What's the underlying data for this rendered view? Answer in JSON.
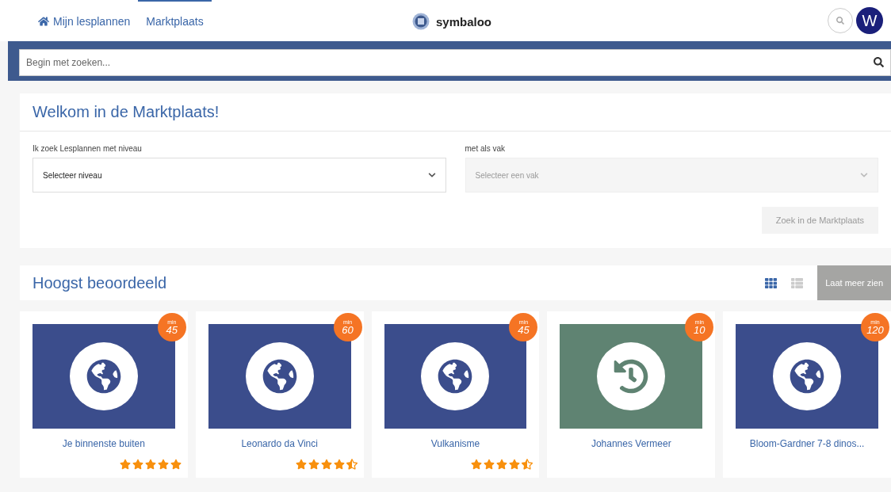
{
  "nav": {
    "tabs": [
      {
        "label": "Mijn lesplannen",
        "selected": false
      },
      {
        "label": "Marktplaats",
        "selected": true
      }
    ],
    "logo": "symbaloo",
    "avatar": "W"
  },
  "search": {
    "placeholder": "Begin met zoeken..."
  },
  "welcome": {
    "title": "Welkom in de Marktplaats!",
    "level_field": {
      "label": "Ik zoek Lesplannen met niveau",
      "value": "Selecteer niveau",
      "disabled": false
    },
    "subject_field": {
      "label": "met als vak",
      "placeholder": "Selecteer een vak",
      "disabled": true
    },
    "submit": {
      "label": "Zoek in de Marktplaats",
      "disabled": true
    }
  },
  "top_rated": {
    "title": "Hoogst beoordeeld",
    "views": [
      {
        "kind": "grid",
        "selected": true
      },
      {
        "kind": "list",
        "selected": false
      }
    ],
    "more": "Laat meer zien",
    "cards": [
      {
        "title": "Je binnenste buiten",
        "unit": "min",
        "minutes": "45",
        "kind": "globe",
        "color": "#3b4d8c",
        "stars": 5
      },
      {
        "title": "Leonardo da Vinci",
        "unit": "min",
        "minutes": "60",
        "kind": "globe",
        "color": "#3b4d8c",
        "stars": 4.5
      },
      {
        "title": "Vulkanisme",
        "unit": "min",
        "minutes": "45",
        "kind": "globe",
        "color": "#3b4d8c",
        "stars": 4.5
      },
      {
        "title": "Johannes Vermeer",
        "unit": "min",
        "minutes": "10",
        "kind": "history",
        "color": "#5f8372"
      },
      {
        "title": "Bloom-Gardner 7-8 dinos...",
        "unit": "min",
        "minutes": "120",
        "kind": "globe",
        "color": "#3b4d8c"
      }
    ]
  }
}
